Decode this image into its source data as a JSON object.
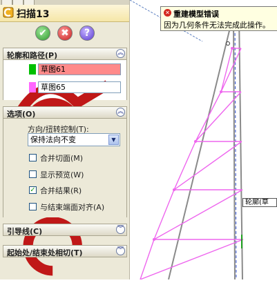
{
  "feature_title": "扫描13",
  "buttons": {
    "ok": "✔",
    "cancel": "✖",
    "help": "?"
  },
  "sections": {
    "profile_path": {
      "label": "轮廓和路径(P)",
      "profile": {
        "value": "草图61",
        "swatch_color": "#00c000",
        "box_color": "#ff8a8a",
        "icon": "profile-icon"
      },
      "path": {
        "value": "草图65",
        "swatch_color": "#ff66ff",
        "icon": "path-icon"
      }
    },
    "options": {
      "label": "选项(O)",
      "orientation_caption": "方向/扭转控制(T):",
      "orientation_value": "保持法向不变",
      "checkboxes": [
        {
          "label": "合并切面(M)",
          "checked": false
        },
        {
          "label": "显示预览(W)",
          "checked": false
        },
        {
          "label": "合并结果(R)",
          "checked": true
        },
        {
          "label": "与结束端面对齐(A)",
          "checked": false
        }
      ]
    },
    "guide_curves": {
      "label": "引导线(C)"
    },
    "start_end_tangency": {
      "label": "起始处/结束处相切(T)"
    }
  },
  "error": {
    "title": "重建模型错误",
    "message": "因为几何条件无法完成此操作。",
    "icon": "error-icon"
  },
  "viewport_callout": "轮廓(草"
}
